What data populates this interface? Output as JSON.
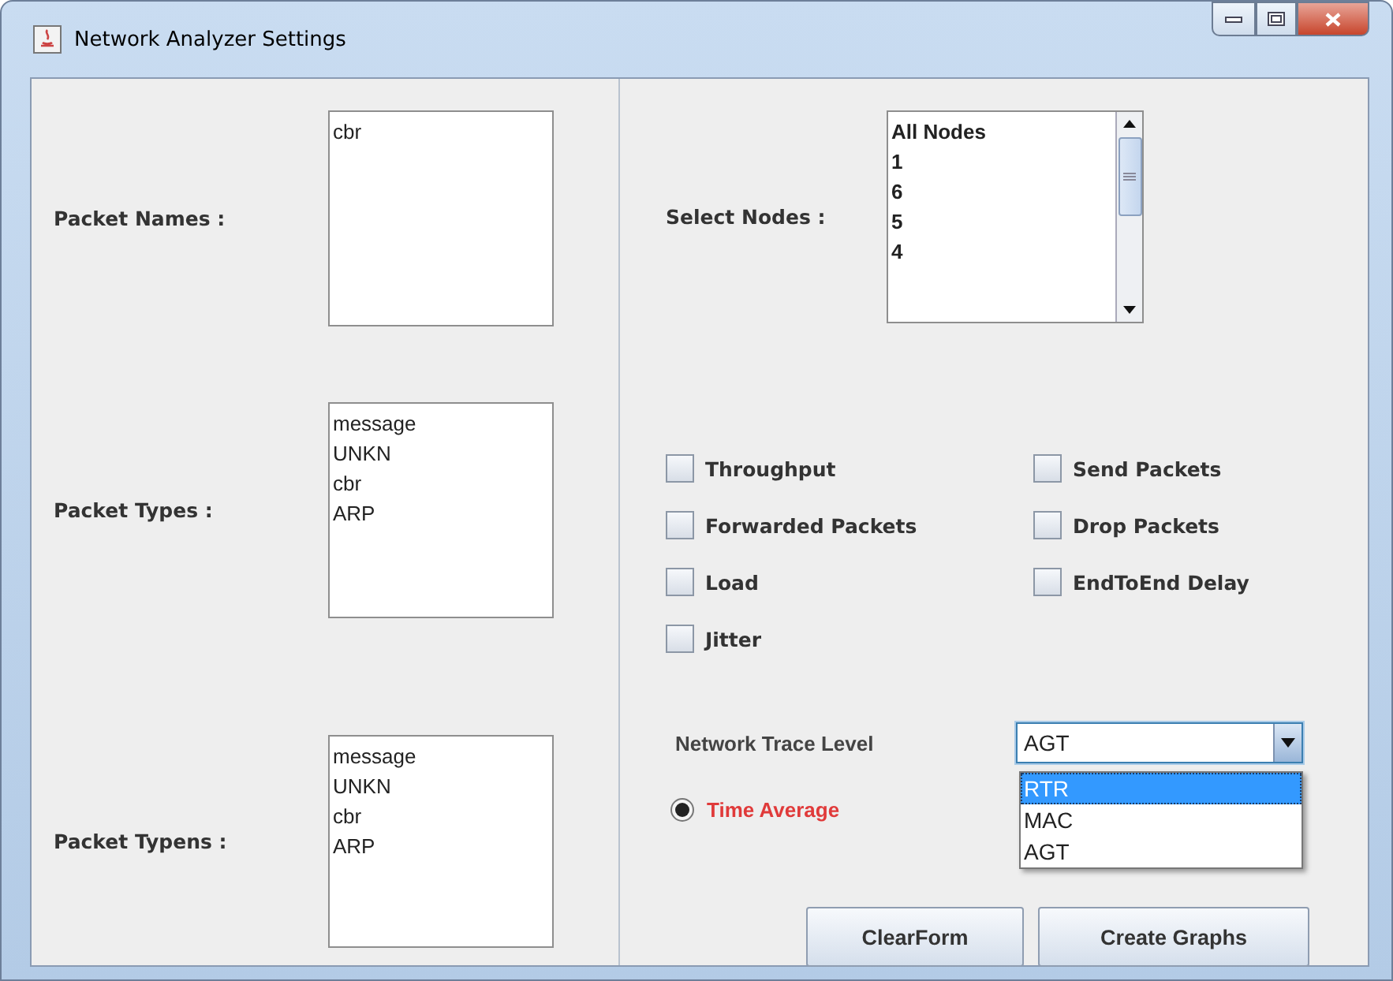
{
  "window": {
    "title": "Network Analyzer Settings"
  },
  "lists": [
    {
      "label": "Packet Names :",
      "items": [
        "cbr"
      ]
    },
    {
      "label": "Packet Types :",
      "items": [
        "message",
        "UNKN",
        "cbr",
        "ARP"
      ]
    },
    {
      "label": "Packet Typens :",
      "items": [
        "message",
        "UNKN",
        "cbr",
        "ARP"
      ]
    }
  ],
  "nodes": {
    "label": "Select Nodes :",
    "items": [
      "All Nodes",
      "1",
      "6",
      "5",
      "4"
    ]
  },
  "checkboxes": [
    {
      "label": "Throughput",
      "checked": false
    },
    {
      "label": "Send Packets",
      "checked": false
    },
    {
      "label": "Forwarded Packets",
      "checked": false
    },
    {
      "label": "Drop Packets",
      "checked": false
    },
    {
      "label": "Load",
      "checked": false
    },
    {
      "label": "EndToEnd Delay",
      "checked": false
    },
    {
      "label": "Jitter",
      "checked": false
    }
  ],
  "trace_level": {
    "label": "Network Trace Level",
    "value": "AGT",
    "expanded": true,
    "options": [
      {
        "label": "RTR",
        "highlighted": true
      },
      {
        "label": "MAC",
        "highlighted": false
      },
      {
        "label": "AGT",
        "highlighted": false
      }
    ]
  },
  "radio": {
    "label": "Time Average",
    "selected": true
  },
  "buttons": [
    "ClearForm",
    "Create Graphs"
  ]
}
